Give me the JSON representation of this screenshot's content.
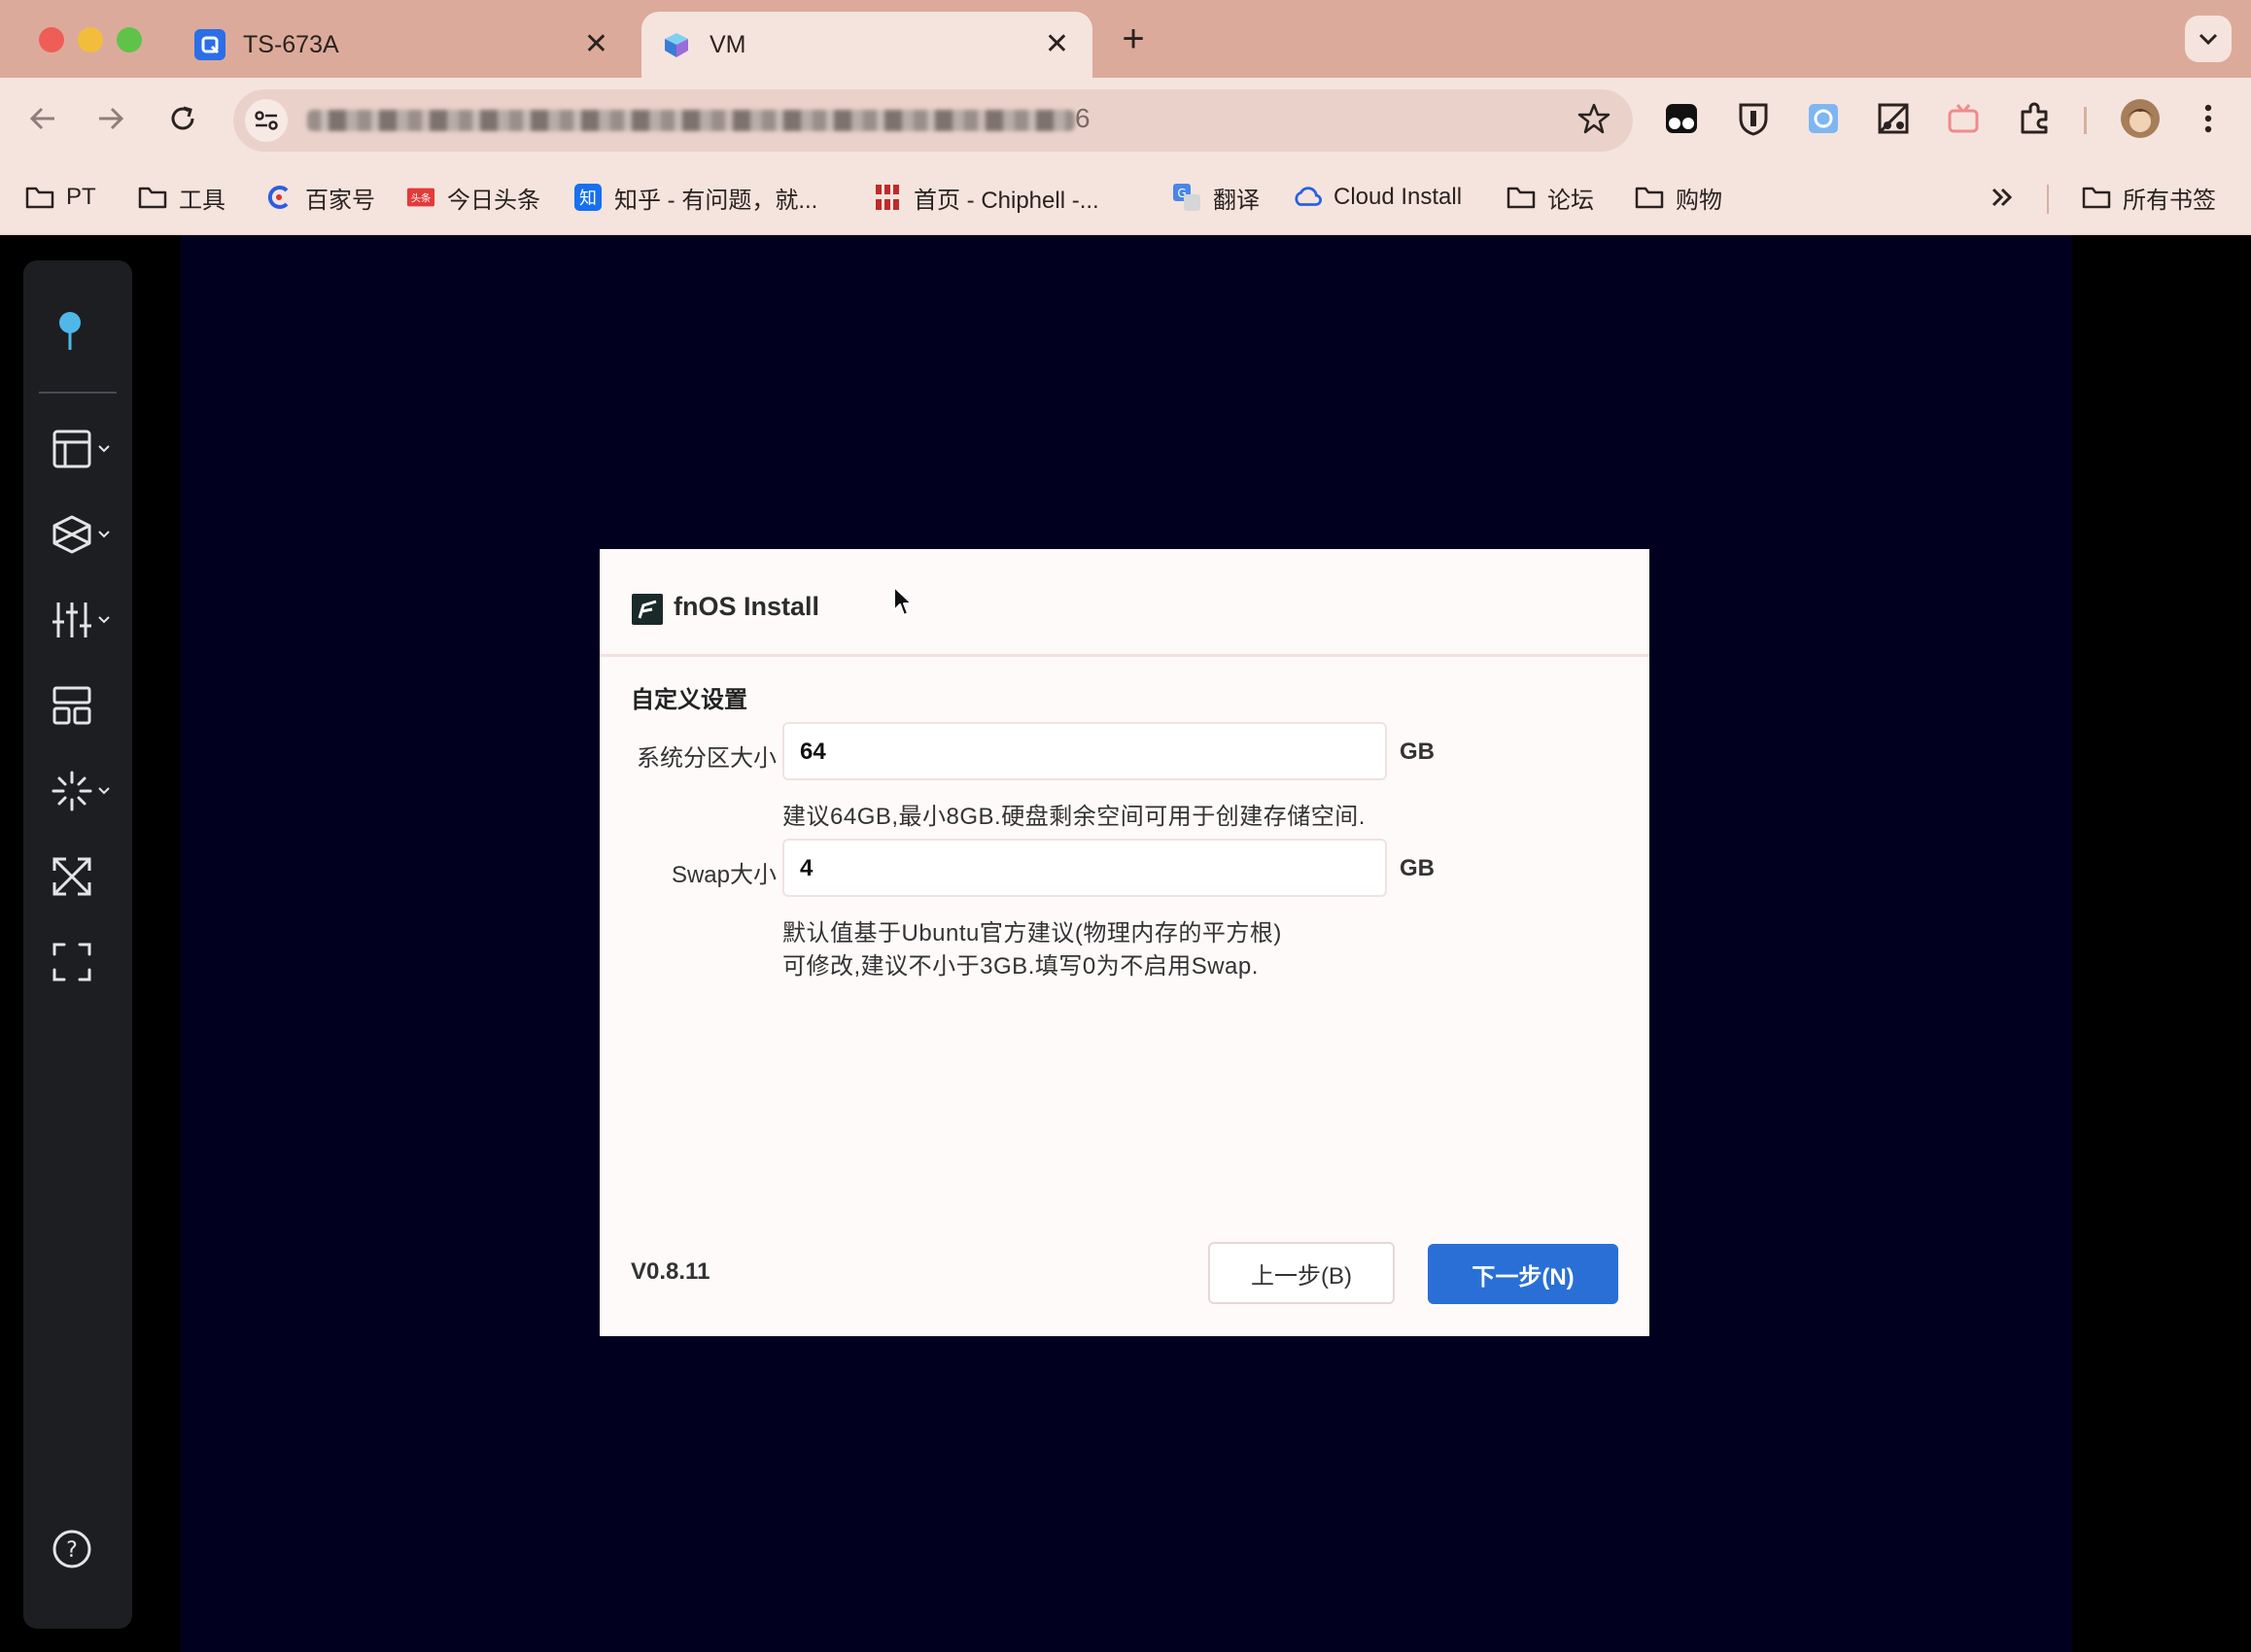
{
  "browser": {
    "tabs": [
      {
        "title": "TS-673A",
        "active": false,
        "favicon_color": "#2b6ee6"
      },
      {
        "title": "VM",
        "active": true
      }
    ],
    "url_suffix": "6",
    "bookmarks": [
      {
        "label": "PT",
        "icon": "folder-icon"
      },
      {
        "label": "工具",
        "icon": "folder-icon"
      },
      {
        "label": "百家号",
        "icon": "baijiahao-icon"
      },
      {
        "label": "今日头条",
        "icon": "toutiao-icon"
      },
      {
        "label": "知乎 - 有问题，就...",
        "icon": "zhihu-icon"
      },
      {
        "label": "首页 - Chiphell -...",
        "icon": "chiphell-icon"
      },
      {
        "label": "翻译",
        "icon": "translate-icon"
      },
      {
        "label": "Cloud Install",
        "icon": "cloud-icon"
      },
      {
        "label": "论坛",
        "icon": "folder-icon"
      },
      {
        "label": "购物",
        "icon": "folder-icon"
      }
    ],
    "all_bookmarks": "所有书签",
    "accent": "#dcaa9a"
  },
  "sidebar": {
    "items": [
      {
        "icon": "pin-icon"
      },
      {
        "icon": "layout-icon",
        "has_menu": true
      },
      {
        "icon": "cube-icon",
        "has_menu": true
      },
      {
        "icon": "sliders-icon",
        "has_menu": true
      },
      {
        "icon": "grid-icon"
      },
      {
        "icon": "spinner-icon",
        "has_menu": true
      },
      {
        "icon": "scale-icon"
      },
      {
        "icon": "fullscreen-icon"
      },
      {
        "icon": "help-icon"
      }
    ]
  },
  "dialog": {
    "title": "fnOS Install",
    "section_title": "自定义设置",
    "system_partition": {
      "label": "系统分区大小",
      "value": "64",
      "unit": "GB",
      "hint": "建议64GB,最小8GB.硬盘剩余空间可用于创建存储空间."
    },
    "swap": {
      "label": "Swap大小",
      "value": "4",
      "unit": "GB",
      "hint_line1": "默认值基于Ubuntu官方建议(物理内存的平方根)",
      "hint_line2": "可修改,建议不小于3GB.填写0为不启用Swap."
    },
    "version": "V0.8.11",
    "back_label": "上一步(B)",
    "next_label": "下一步(N)",
    "primary_color": "#2a6fd6"
  }
}
